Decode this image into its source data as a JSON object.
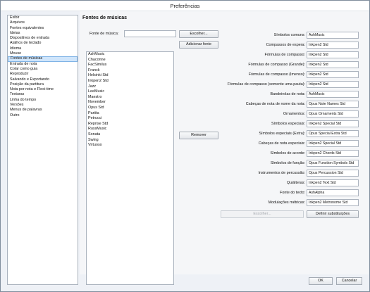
{
  "window": {
    "title": "Preferências"
  },
  "sidebar": {
    "items": [
      {
        "label": "Exibir"
      },
      {
        "label": "Arquivos"
      },
      {
        "label": "Fontes equivalentes"
      },
      {
        "label": "Ideias"
      },
      {
        "label": "Dispositivos de entrada"
      },
      {
        "label": "Atalhos de teclado"
      },
      {
        "label": "Idioma"
      },
      {
        "label": "Mouse"
      },
      {
        "label": "Fontes de músicas",
        "selected": true
      },
      {
        "label": "Entrada de nota"
      },
      {
        "label": "Colar como guia"
      },
      {
        "label": "Reproduzir"
      },
      {
        "label": "Salvando e Exportando"
      },
      {
        "label": "Posição da partitura"
      },
      {
        "label": "Nota por nota e Flexi-time"
      },
      {
        "label": "Texturas"
      },
      {
        "label": "Linha do tempo"
      },
      {
        "label": "Versões"
      },
      {
        "label": "Menus de palavras"
      },
      {
        "label": "Outro"
      }
    ]
  },
  "panel": {
    "heading": "Fontes de músicas",
    "music_font_label": "Fonte de música:",
    "music_font_value": "",
    "choose_button": "Escolher...",
    "add_font_button": "Adicionar fonte",
    "remove_button": "Remover",
    "font_list": [
      "AshMusic",
      "Chaconne",
      "FacSimilus",
      "Franck",
      "Helsinki Std",
      "Inkpen2 Std",
      "Jazz",
      "LeeMusic",
      "Maestro",
      "November",
      "Opus Std",
      "Partita",
      "Petrucci",
      "Reprise Std",
      "RussMusic",
      "Sonata",
      "Swing",
      "Virtuoso"
    ],
    "mappings": [
      {
        "label": "Símbolos comuns:",
        "value": "AshMusic"
      },
      {
        "label": "Compassos de espera:",
        "value": "Inkpen2 Std"
      },
      {
        "label": "Fórmulas de compasso:",
        "value": "Inkpen2 Std"
      },
      {
        "label": "Fórmulas de compasso (Grande):",
        "value": "Inkpen2 Std"
      },
      {
        "label": "Fórmulas de compasso (Imenso):",
        "value": "Inkpen2 Std"
      },
      {
        "label": "Fórmulas de compasso (somente uma pauta):",
        "value": "Inkpen2 Std"
      },
      {
        "label": "Bandeirolas de nota:",
        "value": "AshMusic"
      },
      {
        "label": "Cabeças de nota de nome da nota:",
        "value": "Opus Note Names Std"
      },
      {
        "label": "Ornamentos:",
        "value": "Opus Ornaments Std"
      },
      {
        "label": "Símbolos especiais:",
        "value": "Inkpen2 Special Std"
      },
      {
        "label": "Símbolos especiais (Extra):",
        "value": "Opus Special Extra Std"
      },
      {
        "label": "Cabeças de nota especiais:",
        "value": "Inkpen2 Special Std"
      },
      {
        "label": "Símbolos de acorde:",
        "value": "Inkpen2 Chords Std"
      },
      {
        "label": "Símbolos de função:",
        "value": "Opus Function Symbols Std"
      },
      {
        "label": "Instrumentos de percussão:",
        "value": "Opus Percussion Std"
      },
      {
        "label": "Quiálteras:",
        "value": "Inkpen2 Text Std"
      },
      {
        "label": "Fonte do texto:",
        "value": "AshAlpha"
      },
      {
        "label": "Modulações métricas:",
        "value": "Inkpen2 Metronome Std"
      }
    ],
    "choose_disabled_button": "Escolher...",
    "define_substitutions_button": "Definir substituições"
  },
  "footer": {
    "ok": "OK",
    "cancel": "Cancelar"
  }
}
